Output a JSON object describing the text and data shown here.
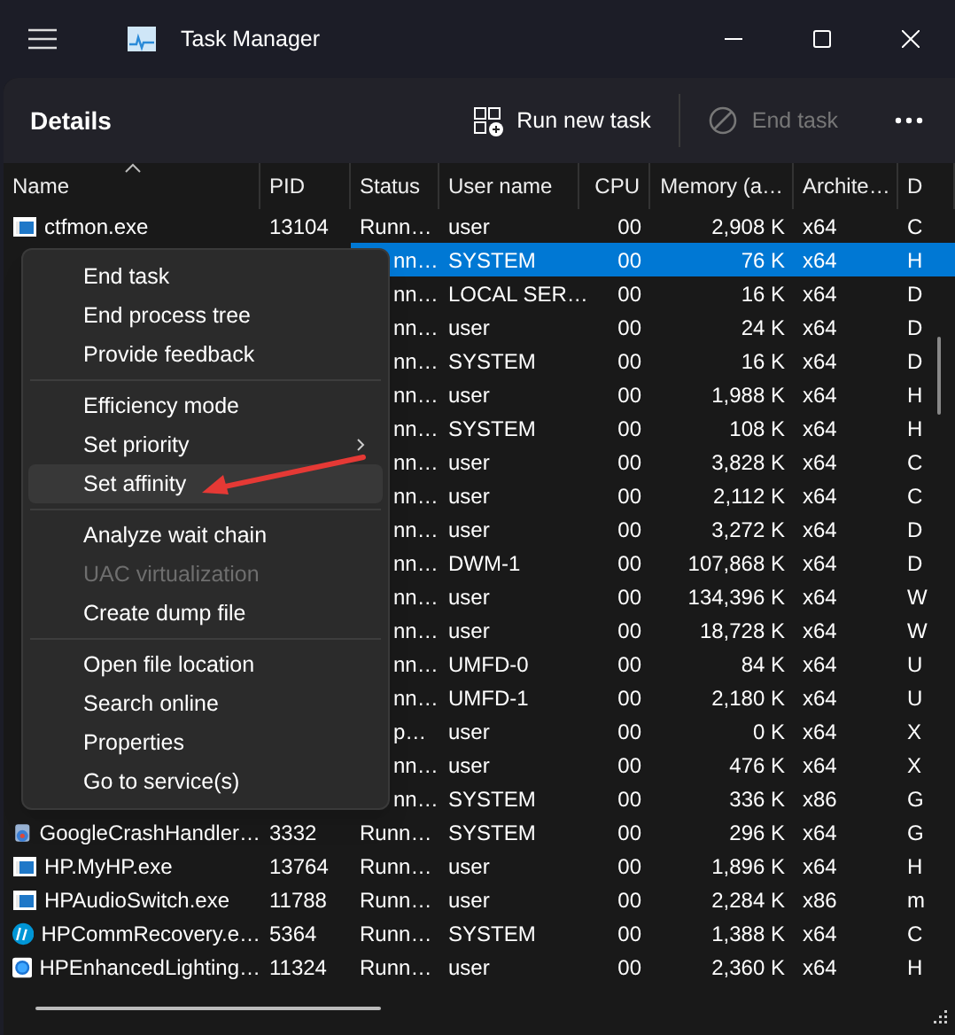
{
  "window": {
    "title": "Task Manager"
  },
  "toolbar": {
    "page_title": "Details",
    "buttons": [
      {
        "label": "Run new task",
        "kind": "run",
        "disabled": false
      },
      {
        "label": "End task",
        "kind": "end",
        "disabled": true
      }
    ]
  },
  "table": {
    "columns": [
      "Name",
      "PID",
      "Status",
      "User name",
      "CPU",
      "Memory (a…",
      "Archite…",
      "D"
    ],
    "rows": [
      {
        "kind": "app",
        "name": "ctfmon.exe",
        "pid": "13104",
        "status": "Runn…",
        "user": "user",
        "cpu": "00",
        "memory": "2,908 K",
        "arch": "x64",
        "column_8": "C",
        "selected": false
      },
      {
        "status": "nn…",
        "user": "SYSTEM",
        "cpu": "00",
        "memory": "76 K",
        "arch": "x64",
        "column_8": "H",
        "selected": true
      },
      {
        "status": "nn…",
        "user": "LOCAL SER…",
        "cpu": "00",
        "memory": "16 K",
        "arch": "x64",
        "column_8": "D",
        "selected": false
      },
      {
        "status": "nn…",
        "user": "user",
        "cpu": "00",
        "memory": "24 K",
        "arch": "x64",
        "column_8": "D",
        "selected": false
      },
      {
        "status": "nn…",
        "user": "SYSTEM",
        "cpu": "00",
        "memory": "16 K",
        "arch": "x64",
        "column_8": "D",
        "selected": false
      },
      {
        "status": "nn…",
        "user": "user",
        "cpu": "00",
        "memory": "1,988 K",
        "arch": "x64",
        "column_8": "H",
        "selected": false
      },
      {
        "status": "nn…",
        "user": "SYSTEM",
        "cpu": "00",
        "memory": "108 K",
        "arch": "x64",
        "column_8": "H",
        "selected": false
      },
      {
        "status": "nn…",
        "user": "user",
        "cpu": "00",
        "memory": "3,828 K",
        "arch": "x64",
        "column_8": "C",
        "selected": false
      },
      {
        "status": "nn…",
        "user": "user",
        "cpu": "00",
        "memory": "2,112 K",
        "arch": "x64",
        "column_8": "C",
        "selected": false
      },
      {
        "status": "nn…",
        "user": "user",
        "cpu": "00",
        "memory": "3,272 K",
        "arch": "x64",
        "column_8": "D",
        "selected": false
      },
      {
        "status": "nn…",
        "user": "DWM-1",
        "cpu": "00",
        "memory": "107,868 K",
        "arch": "x64",
        "column_8": "D",
        "selected": false
      },
      {
        "status": "nn…",
        "user": "user",
        "cpu": "00",
        "memory": "134,396 K",
        "arch": "x64",
        "column_8": "W",
        "selected": false
      },
      {
        "status": "nn…",
        "user": "user",
        "cpu": "00",
        "memory": "18,728 K",
        "arch": "x64",
        "column_8": "W",
        "selected": false
      },
      {
        "status": "nn…",
        "user": "UMFD-0",
        "cpu": "00",
        "memory": "84 K",
        "arch": "x64",
        "column_8": "U",
        "selected": false
      },
      {
        "status": "nn…",
        "user": "UMFD-1",
        "cpu": "00",
        "memory": "2,180 K",
        "arch": "x64",
        "column_8": "U",
        "selected": false
      },
      {
        "status": "p…",
        "user": "user",
        "cpu": "00",
        "memory": "0 K",
        "arch": "x64",
        "column_8": "X",
        "selected": false
      },
      {
        "status": "nn…",
        "user": "user",
        "cpu": "00",
        "memory": "476 K",
        "arch": "x64",
        "column_8": "X",
        "selected": false
      },
      {
        "status": "nn…",
        "user": "SYSTEM",
        "cpu": "00",
        "memory": "336 K",
        "arch": "x86",
        "column_8": "G",
        "selected": false
      },
      {
        "kind": "crash",
        "name": "GoogleCrashHandler…",
        "pid": "3332",
        "status": "Runn…",
        "user": "SYSTEM",
        "cpu": "00",
        "memory": "296 K",
        "arch": "x64",
        "column_8": "G",
        "selected": false
      },
      {
        "kind": "app",
        "name": "HP.MyHP.exe",
        "pid": "13764",
        "status": "Runn…",
        "user": "user",
        "cpu": "00",
        "memory": "1,896 K",
        "arch": "x64",
        "column_8": "H",
        "selected": false
      },
      {
        "kind": "app",
        "name": "HPAudioSwitch.exe",
        "pid": "11788",
        "status": "Runn…",
        "user": "user",
        "cpu": "00",
        "memory": "2,284 K",
        "arch": "x86",
        "column_8": "m",
        "selected": false
      },
      {
        "kind": "logo",
        "name": "HPCommRecovery.e…",
        "pid": "5364",
        "status": "Runn…",
        "user": "SYSTEM",
        "cpu": "00",
        "memory": "1,388 K",
        "arch": "x64",
        "column_8": "C",
        "selected": false
      },
      {
        "kind": "ring",
        "name": "HPEnhancedLighting…",
        "pid": "11324",
        "status": "Runn…",
        "user": "user",
        "cpu": "00",
        "memory": "2,360 K",
        "arch": "x64",
        "column_8": "H",
        "selected": false
      }
    ]
  },
  "context_menu": {
    "groups": [
      [
        {
          "label": "End task",
          "disabled": false,
          "highlighted": false,
          "submenu": false
        },
        {
          "label": "End process tree",
          "disabled": false,
          "highlighted": false,
          "submenu": false
        },
        {
          "label": "Provide feedback",
          "disabled": false,
          "highlighted": false,
          "submenu": false
        }
      ],
      [
        {
          "label": "Efficiency mode",
          "disabled": false,
          "highlighted": false,
          "submenu": false
        },
        {
          "label": "Set priority",
          "disabled": false,
          "highlighted": false,
          "submenu": true
        },
        {
          "label": "Set affinity",
          "disabled": false,
          "highlighted": true,
          "submenu": false
        }
      ],
      [
        {
          "label": "Analyze wait chain",
          "disabled": false,
          "highlighted": false,
          "submenu": false
        },
        {
          "label": "UAC virtualization",
          "disabled": true,
          "highlighted": false,
          "submenu": false
        },
        {
          "label": "Create dump file",
          "disabled": false,
          "highlighted": false,
          "submenu": false
        }
      ],
      [
        {
          "label": "Open file location",
          "disabled": false,
          "highlighted": false,
          "submenu": false
        },
        {
          "label": "Search online",
          "disabled": false,
          "highlighted": false,
          "submenu": false
        },
        {
          "label": "Properties",
          "disabled": false,
          "highlighted": false,
          "submenu": false
        },
        {
          "label": "Go to service(s)",
          "disabled": false,
          "highlighted": false,
          "submenu": false
        }
      ]
    ]
  }
}
